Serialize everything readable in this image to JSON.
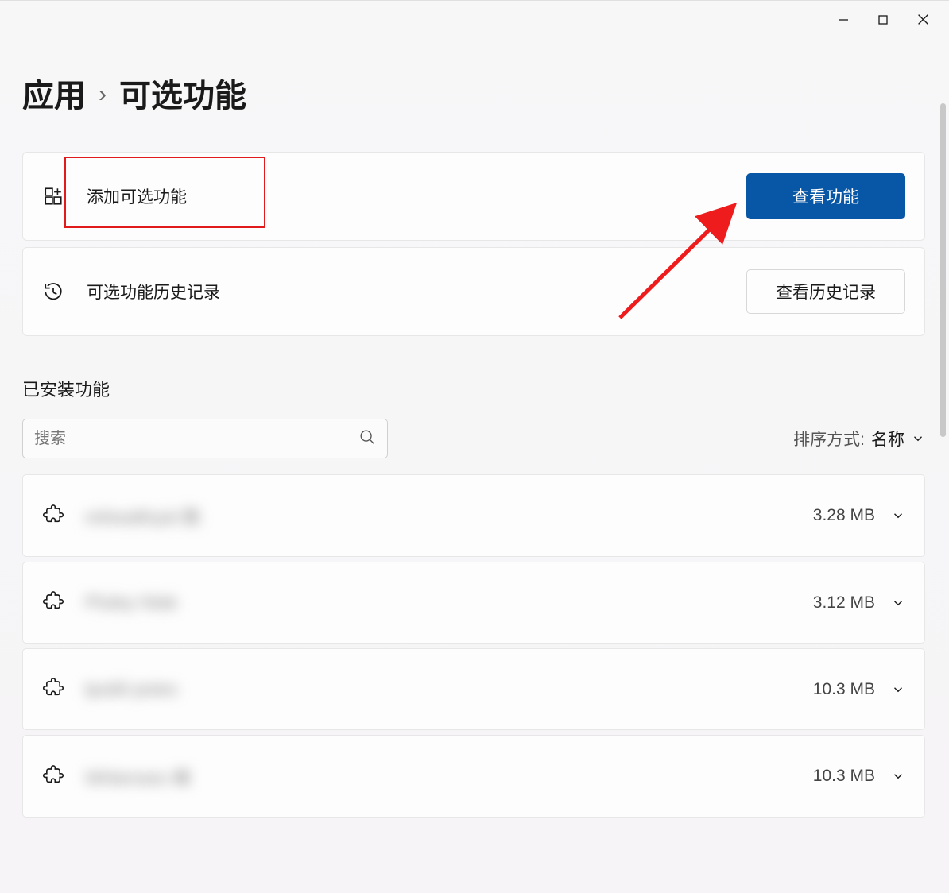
{
  "breadcrumb": {
    "parent": "应用",
    "current": "可选功能"
  },
  "cards": {
    "add": {
      "title": "添加可选功能",
      "button": "查看功能"
    },
    "history": {
      "title": "可选功能历史记录",
      "button": "查看历史记录"
    }
  },
  "installed": {
    "heading": "已安装功能",
    "search_placeholder": "搜索",
    "sort_label": "排序方式:",
    "sort_value": "名称"
  },
  "features": [
    {
      "name": "mihealthyid 数",
      "size": "3.28 MB"
    },
    {
      "name": "Pluley hilak",
      "size": "3.12 MB"
    },
    {
      "name": "tpubli poies",
      "size": "10.3 MB"
    },
    {
      "name": "Whtenoes 峰",
      "size": "10.3 MB"
    }
  ]
}
